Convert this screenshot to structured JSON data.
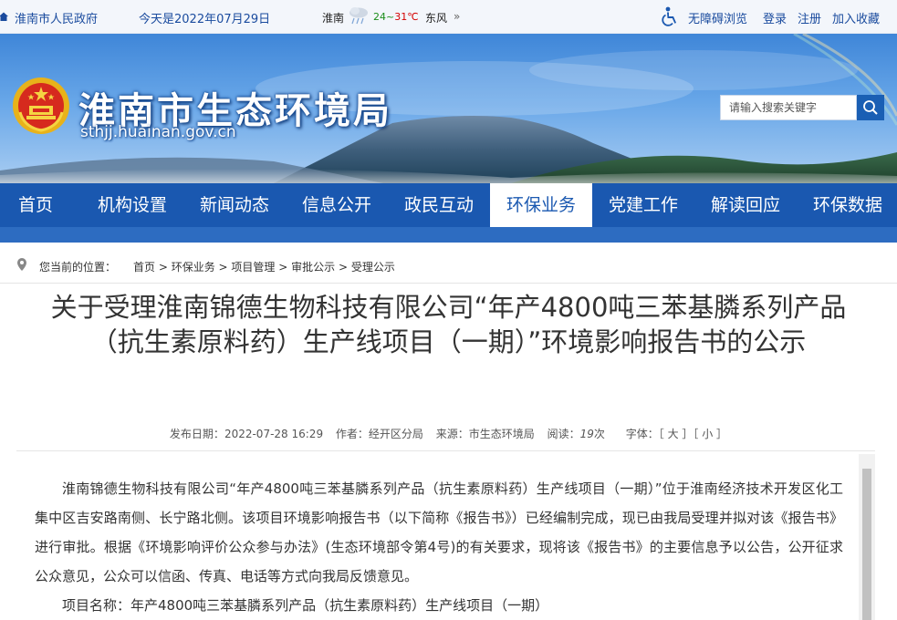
{
  "topbar": {
    "gov_link": "淮南市人民政府",
    "date_text": "今天是2022年07月29日",
    "weather_city": "淮南",
    "weather_temp_low": "24",
    "weather_temp_sep": "~",
    "weather_temp_high": "31℃",
    "weather_wind": "东风",
    "weather_wind_arrow": "»",
    "accessibility": "无障碍浏览",
    "login": "登录",
    "register": "注册",
    "favorite": "加入收藏"
  },
  "header": {
    "site_title": "淮南市生态环境局",
    "site_url": "sthjj.huainan.gov.cn",
    "search_placeholder": "请输入搜索关键字"
  },
  "nav": {
    "items": [
      "首页",
      "机构设置",
      "新闻动态",
      "信息公开",
      "政民互动",
      "环保业务",
      "党建工作",
      "解读回应",
      "环保数据"
    ],
    "active": "环保业务"
  },
  "breadcrumb": {
    "label": "您当前的位置：",
    "items": [
      "首页",
      "环保业务",
      "项目管理",
      "审批公示",
      "受理公示"
    ],
    "separator": " > "
  },
  "article": {
    "title": "关于受理淮南锦德生物科技有限公司“年产4800吨三苯基膦系列产品（抗生素原料药）生产线项目（一期）”环境影响报告书的公示",
    "meta": {
      "publish_label": "发布日期：",
      "publish_date": "2022-07-28 16:29",
      "author_label": "作者：",
      "author": "经开区分局",
      "source_label": "来源：",
      "source": "市生态环境局",
      "views_label": "阅读：",
      "views": "19",
      "views_unit": "次",
      "font_label": "字体：",
      "font_large": "［ 大 ］",
      "font_small": "［ 小 ］"
    },
    "paragraphs": [
      "淮南锦德生物科技有限公司“年产4800吨三苯基膦系列产品（抗生素原料药）生产线项目（一期）”位于淮南经济技术开发区化工集中区吉安路南侧、长宁路北侧。该项目环境影响报告书（以下简称《报告书》）已经编制完成，现已由我局受理并拟对该《报告书》进行审批。根据《环境影响评价公众参与办法》(生态环境部令第4号)的有关要求，现将该《报告书》的主要信息予以公告，公开征求公众意见，公众可以信函、传真、电话等方式向我局反馈意见。",
      "项目名称：年产4800吨三苯基膦系列产品（抗生素原料药）生产线项目（一期）"
    ]
  },
  "colors": {
    "nav_bg": "#1a58b0",
    "link_blue": "#1a4b9e",
    "page_bg": "#ffffff"
  }
}
